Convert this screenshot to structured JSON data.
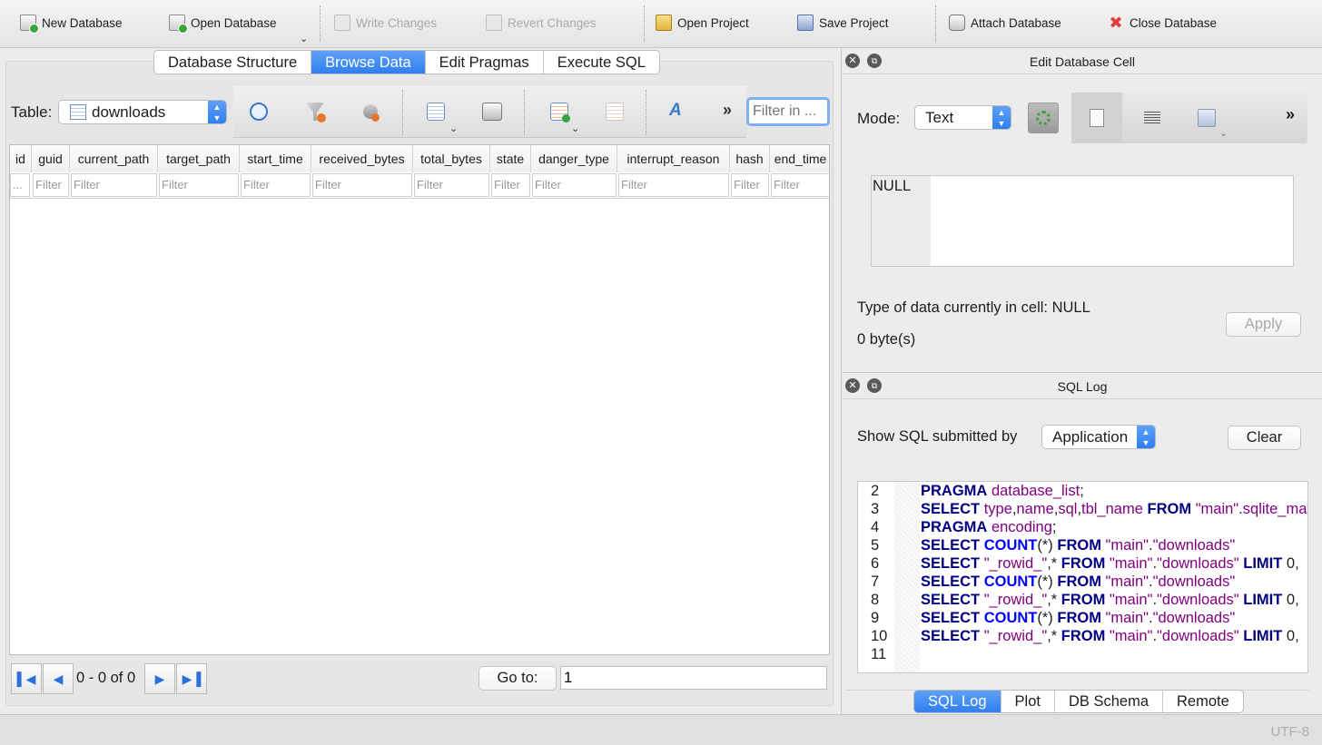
{
  "toolbar": {
    "new_database": "New Database",
    "open_database": "Open Database",
    "write_changes": "Write Changes",
    "revert_changes": "Revert Changes",
    "open_project": "Open Project",
    "save_project": "Save Project",
    "attach_database": "Attach Database",
    "close_database": "Close Database"
  },
  "tabs": [
    "Database Structure",
    "Browse Data",
    "Edit Pragmas",
    "Execute SQL"
  ],
  "active_tab": "Browse Data",
  "browse": {
    "table_label": "Table:",
    "table_value": "downloads",
    "filter_placeholder": "Filter in ...",
    "columns": [
      "id",
      "guid",
      "current_path",
      "target_path",
      "start_time",
      "received_bytes",
      "total_bytes",
      "state",
      "danger_type",
      "interrupt_reason",
      "hash",
      "end_time"
    ],
    "filter_cells": [
      "...",
      "Filter",
      "Filter",
      "Filter",
      "Filter",
      "Filter",
      "Filter",
      "Filter",
      "Filter",
      "Filter",
      "Filter",
      "Filter"
    ],
    "record_status": "0 - 0 of 0",
    "goto_label": "Go to:",
    "goto_value": "1"
  },
  "edit_cell": {
    "title": "Edit Database Cell",
    "mode_label": "Mode:",
    "mode_value": "Text",
    "cell_value": "NULL",
    "type_info": "Type of data currently in cell: NULL",
    "size_info": "0 byte(s)",
    "apply": "Apply"
  },
  "sql_log": {
    "title": "SQL Log",
    "show_label": "Show SQL submitted by",
    "source_value": "Application",
    "clear": "Clear",
    "line_numbers": [
      "2",
      "3",
      "4",
      "5",
      "6",
      "7",
      "8",
      "9",
      "10",
      "11"
    ]
  },
  "bottom_tabs": [
    "SQL Log",
    "Plot",
    "DB Schema",
    "Remote"
  ],
  "active_bottom_tab": "SQL Log",
  "status": {
    "encoding": "UTF-8"
  },
  "colors": {
    "accent": "#2f7ff0",
    "keyword": "#000080",
    "function": "#0000ff",
    "identifier": "#800080"
  }
}
